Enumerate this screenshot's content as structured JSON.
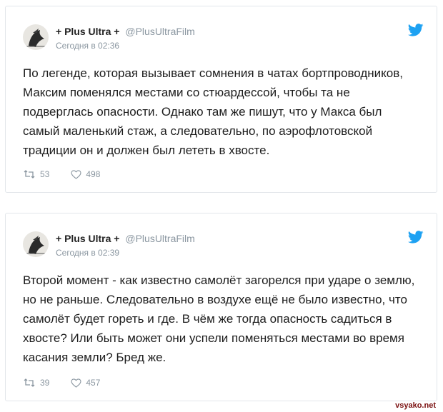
{
  "tweets": [
    {
      "author": "+ Plus Ultra +",
      "handle": "@PlusUltraFilm",
      "time": "Сегодня в 02:36",
      "text": "По легенде, которая вызывает сомнения в чатах бортпроводников, Максим поменялся местами со стюардессой, чтобы та не подверглась опасности. Однако там же пишут, что у Макса был самый маленький стаж, а следовательно, по аэрофлотовской традиции он и должен был лететь в хвосте.",
      "retweets": "53",
      "likes": "498"
    },
    {
      "author": "+ Plus Ultra +",
      "handle": "@PlusUltraFilm",
      "time": "Сегодня в 02:39",
      "text": "Второй момент - как известно самолёт загорелся при ударе о землю, но не раньше. Следовательно в воздухе ещё не было известно, что самолёт будет гореть и где. В чём же тогда опасность садиться в хвосте? Или быть может они успели поменяться местами во время касания земли? Бред же.",
      "retweets": "39",
      "likes": "457"
    }
  ],
  "watermark": "vsyako.net",
  "colors": {
    "twitter_blue": "#1da1f2",
    "muted": "#8a96a0"
  }
}
